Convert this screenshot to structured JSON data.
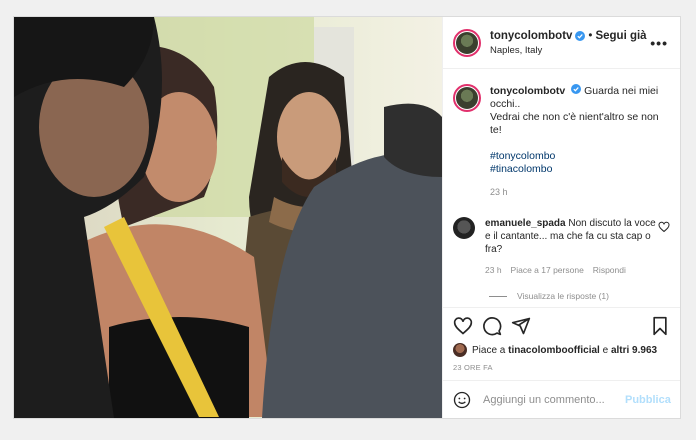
{
  "post": {
    "username": "tonycolombotv",
    "follow_label": "Segui già",
    "location": "Naples, Italy",
    "more_label": "•••",
    "caption": {
      "username": "tonycolombotv",
      "line1": "Guarda nei miei occhi..",
      "line2": "Vedrai che non c'è nient'altro se non te!",
      "hashtags": [
        "#tonycolombo",
        "#tinacolombo"
      ],
      "time": "23 h"
    },
    "comment": {
      "username": "emanuele_spada",
      "text": "Non discuto la voce e il cantante... ma che fa cu sta cap o fra?",
      "time": "23 h",
      "likes": "Piace a 17 persone",
      "reply": "Rispondi",
      "view_replies": "Visualizza le risposte (1)"
    },
    "likes": {
      "prefix": "Piace a",
      "user": "tinacolomboofficial",
      "joiner": "e",
      "others": "altri 9.963"
    },
    "ago": "23 ORE FA",
    "add_comment_placeholder": "Aggiungi un commento...",
    "publish_label": "Pubblica"
  },
  "colors": {
    "accent": "#0095f6",
    "publish_disabled": "#b2dffc",
    "hashtag": "#00376b"
  },
  "icons": [
    "verified-icon",
    "more-icon",
    "heart-icon",
    "comment-icon",
    "share-icon",
    "bookmark-icon",
    "emoji-icon"
  ]
}
